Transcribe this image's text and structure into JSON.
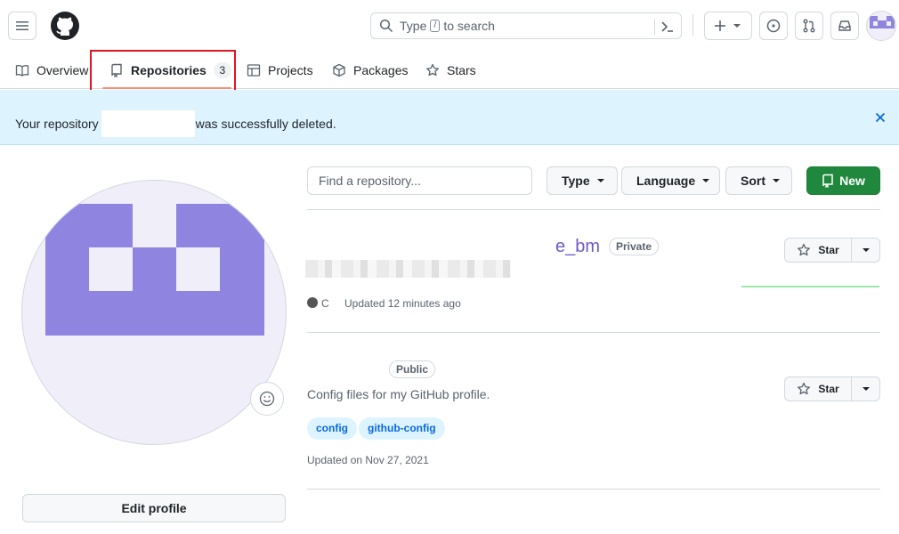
{
  "header": {
    "search_placeholder_before": "Type",
    "search_key": "/",
    "search_placeholder_after": "to search"
  },
  "tabs": [
    {
      "label": "Overview"
    },
    {
      "label": "Repositories",
      "count": "3"
    },
    {
      "label": "Projects"
    },
    {
      "label": "Packages"
    },
    {
      "label": "Stars"
    }
  ],
  "flash": {
    "prefix": "Your repository",
    "suffix": "was successfully deleted."
  },
  "profile": {
    "edit_label": "Edit profile"
  },
  "filters": {
    "find_placeholder": "Find a repository...",
    "type_label": "Type",
    "language_label": "Language",
    "sort_label": "Sort",
    "new_label": "New"
  },
  "repos": [
    {
      "name_visible": "e_bm",
      "visibility": "Private",
      "language": "C",
      "language_color": "#555555",
      "updated": "Updated 12 minutes ago",
      "star_label": "Star"
    },
    {
      "visibility": "Public",
      "description": "Config files for my GitHub profile.",
      "topics": [
        "config",
        "github-config"
      ],
      "updated": "Updated on Nov 27, 2021",
      "star_label": "Star"
    }
  ],
  "colors": {
    "accent": "#0969da",
    "primary_button": "#1f883d",
    "flash_bg": "#ddf4ff",
    "avatar_purple": "#8f85e0",
    "tab_underline": "#fd8c73"
  }
}
